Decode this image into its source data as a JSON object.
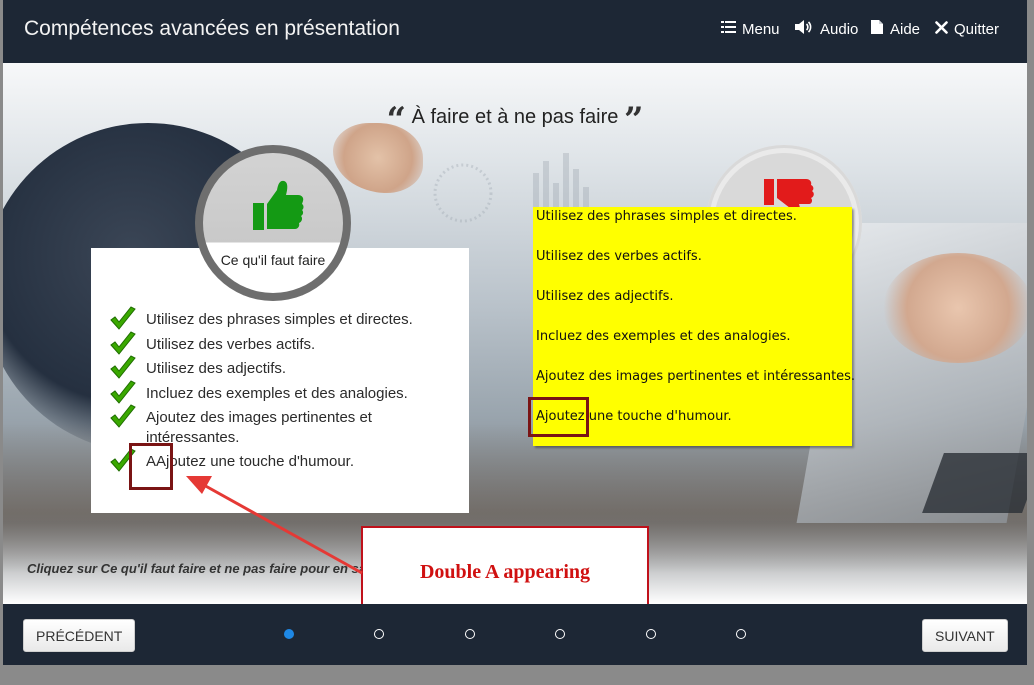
{
  "header": {
    "title": "Compétences avancées en présentation",
    "nav": [
      {
        "label": "Menu",
        "icon": "list-icon"
      },
      {
        "label": "Audio",
        "icon": "speaker-icon"
      },
      {
        "label": "Aide",
        "icon": "document-icon"
      },
      {
        "label": "Quitter",
        "icon": "close-icon"
      }
    ]
  },
  "slide": {
    "title": "À faire et à ne pas faire",
    "title_open_quote": "“",
    "title_close_quote": "”",
    "do_label": "Ce qu'il faut faire",
    "do_icon": "thumbs-up-icon",
    "dont_icon": "thumbs-down-icon",
    "do_items": [
      "Utilisez des phrases simples et directes.",
      "Utilisez des verbes actifs.",
      "Utilisez des adjectifs.",
      "Incluez des exemples et des analogies.",
      "Ajoutez des images pertinentes et intéressantes.",
      "AAjoutez une touche d'humour."
    ],
    "yellow_items": [
      "Utilisez des phrases simples et directes.",
      "Utilisez des verbes actifs.",
      "Utilisez des adjectifs.",
      "Incluez des exemples et des analogies.",
      "Ajoutez des images pertinentes et intéressantes.",
      "Ajoutez une touche d'humour."
    ],
    "instruction": "Cliquez sur Ce qu'il faut faire et ne pas faire pour en savo"
  },
  "annotation": {
    "callout_text": "Double A appearing"
  },
  "footer": {
    "prev_label": "PRÉCÉDENT",
    "next_label": "SUIVANT",
    "dots_total": 6,
    "active_dot": 1
  },
  "colors": {
    "bar": "#1d2735",
    "check": "#3aa800",
    "thumb_up": "#149a14",
    "thumb_down": "#e21b1b",
    "highlight": "#ffff00",
    "annotation": "#c0111b",
    "active_dot": "#1e88e5"
  }
}
